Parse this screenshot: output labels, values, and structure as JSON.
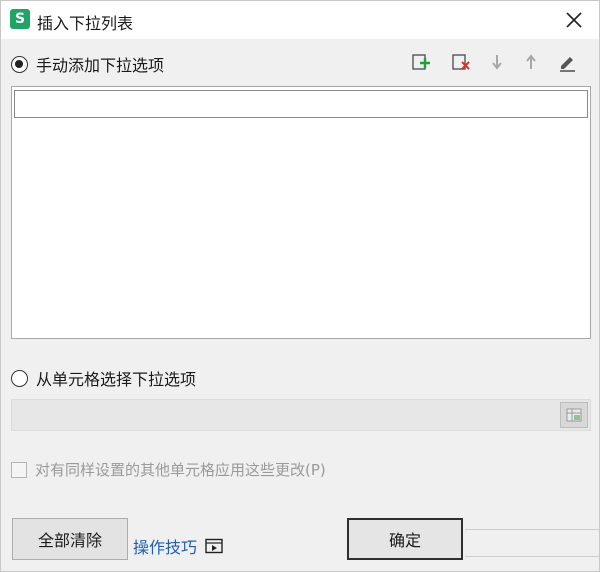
{
  "dialog": {
    "title": "插入下拉列表",
    "app_icon_letter": "S"
  },
  "manual": {
    "label": "手动添加下拉选项",
    "selected": true,
    "toolbar_icons": [
      "add-item-icon",
      "delete-item-icon",
      "move-down-icon",
      "move-up-icon",
      "edit-icon"
    ],
    "input_value": ""
  },
  "from_cells": {
    "label": "从单元格选择下拉选项",
    "selected": false,
    "range_value": ""
  },
  "apply_all": {
    "label": "对有同样设置的其他单元格应用这些更改(P)",
    "checked": false
  },
  "buttons": {
    "clear_all": "全部清除",
    "ok": "确定"
  },
  "tips": {
    "label": "操作技巧"
  },
  "colors": {
    "accent_green": "#21a366",
    "link_blue": "#1e5fb4"
  }
}
